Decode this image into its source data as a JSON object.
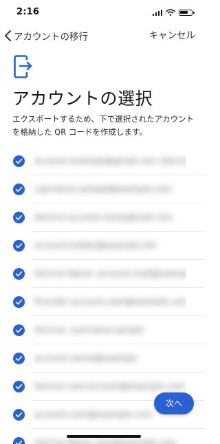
{
  "status_bar": {
    "time": "2:16",
    "icons": [
      "cellular-signal-icon",
      "wifi-icon",
      "battery-icon"
    ]
  },
  "nav": {
    "back_label": "アカウントの移行",
    "cancel_label": "キャンセル"
  },
  "header": {
    "icon": "export-phone-icon",
    "title": "アカウントの選択",
    "description": "エクスポートするため、下で選択されたアカウントを格納した QR コードを作成します。"
  },
  "accounts": [
    {
      "checked": true,
      "label": "account.example@gmail.com (Service Name)"
    },
    {
      "checked": true,
      "label": "username.sample@example.com"
    },
    {
      "checked": true,
      "label": "Service account.name@mail.com"
    },
    {
      "checked": true,
      "label": "account.holder@example.net"
    },
    {
      "checked": true,
      "label": "Service Name: account.mail@example.com"
    },
    {
      "checked": true,
      "label": "Provider account.user@example.com"
    },
    {
      "checked": true,
      "label": "Service: username.sample"
    },
    {
      "checked": true,
      "label": "account.name@example"
    },
    {
      "checked": true,
      "label": "Service user.account@example.com (Name)"
    },
    {
      "checked": true,
      "label": "account.user@example.com"
    },
    {
      "checked": true,
      "label": "Service Name user@example.com"
    }
  ],
  "next_label": "次へ",
  "colors": {
    "accent": "#2761d4",
    "check_fill": "#2761d4"
  }
}
